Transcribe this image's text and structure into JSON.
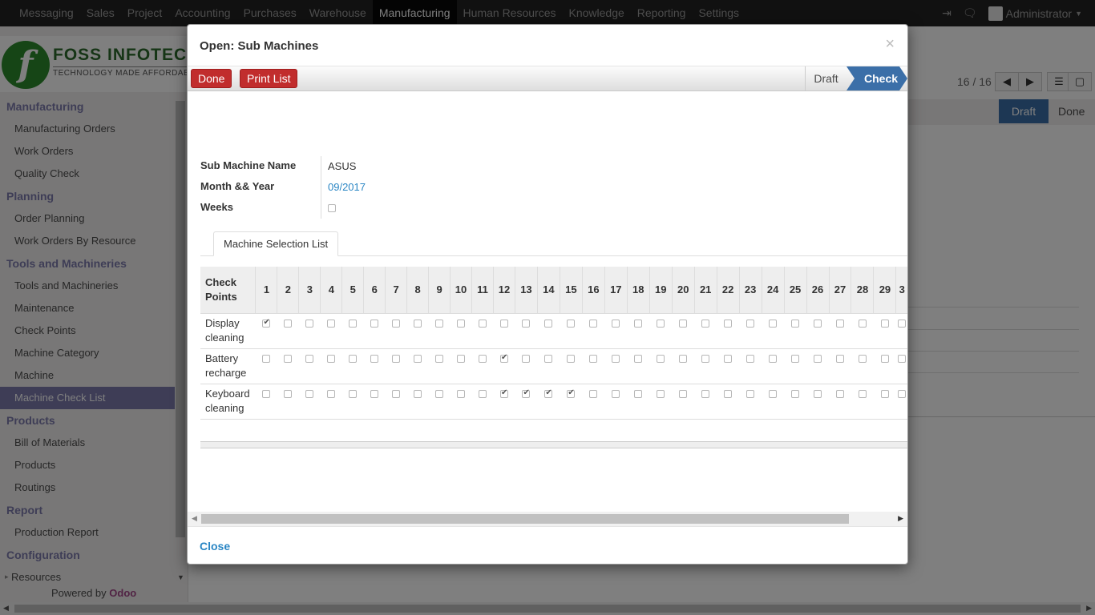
{
  "topbar": {
    "menu": [
      "Messaging",
      "Sales",
      "Project",
      "Accounting",
      "Purchases",
      "Warehouse",
      "Manufacturing",
      "Human Resources",
      "Knowledge",
      "Reporting",
      "Settings"
    ],
    "active": "Manufacturing",
    "user": "Administrator"
  },
  "logo": {
    "name": "FOSS INFOTECH",
    "tagline": "TECHNOLOGY MADE AFFORDABLE"
  },
  "sidebar": {
    "sections": [
      {
        "title": "Manufacturing",
        "items": [
          "Manufacturing Orders",
          "Work Orders",
          "Quality Check"
        ]
      },
      {
        "title": "Planning",
        "items": [
          "Order Planning",
          "Work Orders By Resource"
        ]
      },
      {
        "title": "Tools and Machineries",
        "items": [
          "Tools and Machineries",
          "Maintenance",
          "Check Points",
          "Machine Category",
          "Machine",
          "Machine Check List"
        ]
      },
      {
        "title": "Products",
        "items": [
          "Bill of Materials",
          "Products",
          "Routings"
        ]
      },
      {
        "title": "Report",
        "items": [
          "Production Report"
        ]
      },
      {
        "title": "Configuration",
        "items": []
      }
    ],
    "active_item": "Machine Check List",
    "resources": "Resources",
    "powered_by": "Powered by",
    "powered_brand": "Odoo"
  },
  "background": {
    "pager": "16 / 16",
    "status_draft": "Draft",
    "status_done": "Done"
  },
  "modal": {
    "title": "Open: Sub Machines",
    "done_label": "Done",
    "print_label": "Print List",
    "status_draft": "Draft",
    "status_check": "Check",
    "fields": {
      "sub_machine_label": "Sub Machine Name",
      "sub_machine_value": "ASUS",
      "month_label": "Month && Year",
      "month_value": "09/2017",
      "weeks_label": "Weeks"
    },
    "tab_label": "Machine Selection List",
    "grid": {
      "header_first": "Check Points",
      "days": [
        "1",
        "2",
        "3",
        "4",
        "5",
        "6",
        "7",
        "8",
        "9",
        "10",
        "11",
        "12",
        "13",
        "14",
        "15",
        "16",
        "17",
        "18",
        "19",
        "20",
        "21",
        "22",
        "23",
        "24",
        "25",
        "26",
        "27",
        "28",
        "29",
        "3"
      ],
      "rows": [
        {
          "name": "Display cleaning",
          "checked": [
            1
          ]
        },
        {
          "name": "Battery recharge",
          "checked": [
            12
          ]
        },
        {
          "name": "Keyboard cleaning",
          "checked": [
            12,
            13,
            14,
            15
          ]
        }
      ]
    },
    "close_label": "Close"
  }
}
